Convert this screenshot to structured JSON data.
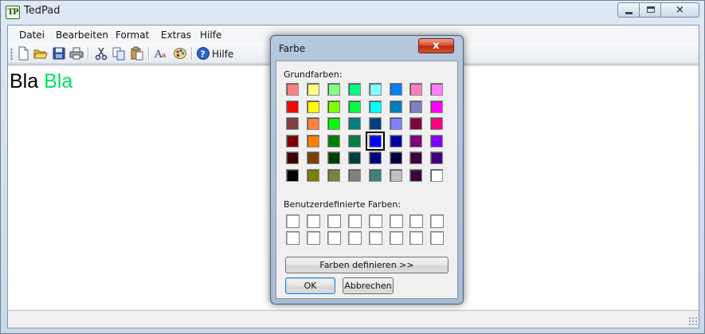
{
  "window": {
    "title": "TedPad",
    "icon_text": "TP"
  },
  "menu": [
    "Datei",
    "Bearbeiten",
    "Format",
    "Extras",
    "Hilfe"
  ],
  "toolbar": {
    "buttons": [
      "new-file-icon",
      "open-folder-icon",
      "save-icon",
      "print-icon",
      "cut-icon",
      "copy-icon",
      "paste-icon",
      "font-icon",
      "color-palette-icon",
      "help-icon"
    ],
    "help_label": "Hilfe"
  },
  "editor": {
    "runs": [
      {
        "text": "Bla",
        "color": "#000000"
      },
      {
        "text": "Bla",
        "color": "#00e060"
      }
    ]
  },
  "dialog": {
    "title": "Farbe",
    "close_glyph": "x",
    "basic_colors_label": "Grundfarben:",
    "basic_colors": [
      [
        "#ff8080",
        "#ffff80",
        "#80ff80",
        "#00ff80",
        "#80ffff",
        "#0080ff",
        "#ff80c0",
        "#ff80ff"
      ],
      [
        "#ff0000",
        "#ffff00",
        "#80ff00",
        "#00ff40",
        "#00ffff",
        "#0080c0",
        "#8080c0",
        "#ff00ff"
      ],
      [
        "#804040",
        "#ff8040",
        "#00ff00",
        "#008080",
        "#004080",
        "#8080ff",
        "#800040",
        "#ff0080"
      ],
      [
        "#800000",
        "#ff8000",
        "#008000",
        "#008040",
        "#0000ff",
        "#0000a0",
        "#800080",
        "#8000ff"
      ],
      [
        "#400000",
        "#804000",
        "#004000",
        "#004040",
        "#000080",
        "#000040",
        "#400040",
        "#400080"
      ],
      [
        "#000000",
        "#808000",
        "#808040",
        "#808080",
        "#408080",
        "#c0c0c0",
        "#400040",
        "#ffffff"
      ]
    ],
    "selected_color": "#0000ff",
    "custom_colors_label": "Benutzerdefinierte Farben:",
    "define_button": "Farben definieren >>",
    "ok_button": "OK",
    "cancel_button": "Abbrechen"
  }
}
